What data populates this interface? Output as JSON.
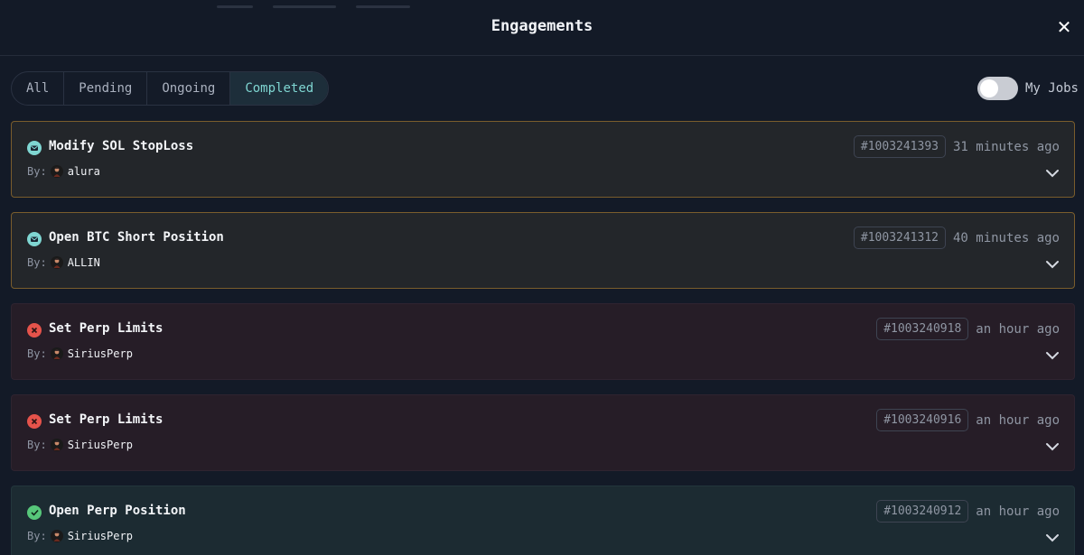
{
  "header": {
    "title": "Engagements",
    "close_icon": "close-icon"
  },
  "tabs": [
    {
      "label": "All",
      "active": false
    },
    {
      "label": "Pending",
      "active": false
    },
    {
      "label": "Ongoing",
      "active": false
    },
    {
      "label": "Completed",
      "active": true
    }
  ],
  "my_jobs": {
    "label": "My Jobs",
    "enabled": false
  },
  "by_label": "By:",
  "jobs": [
    {
      "title": "Modify SOL StopLoss",
      "author": "alura",
      "id": "#1003241393",
      "time": "31 minutes ago",
      "status": "pending",
      "status_icon": "message-icon"
    },
    {
      "title": "Open BTC Short Position",
      "author": "ALLIN",
      "id": "#1003241312",
      "time": "40 minutes ago",
      "status": "pending",
      "status_icon": "message-icon"
    },
    {
      "title": "Set Perp Limits",
      "author": "SiriusPerp",
      "id": "#1003240918",
      "time": "an hour ago",
      "status": "failed",
      "status_icon": "error-icon"
    },
    {
      "title": "Set Perp Limits",
      "author": "SiriusPerp",
      "id": "#1003240916",
      "time": "an hour ago",
      "status": "failed",
      "status_icon": "error-icon"
    },
    {
      "title": "Open Perp Position",
      "author": "SiriusPerp",
      "id": "#1003240912",
      "time": "an hour ago",
      "status": "completed",
      "status_icon": "check-icon"
    }
  ],
  "colors": {
    "accent": "#7fd6d2",
    "error": "#e5534b",
    "success": "#57c77a",
    "ongoing_border": "#7a5d2c"
  }
}
